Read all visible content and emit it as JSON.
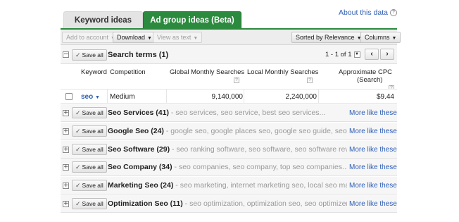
{
  "tabs": {
    "keyword_ideas": "Keyword ideas",
    "ad_group_ideas": "Ad group ideas (Beta)"
  },
  "about": "About this data",
  "help_glyph": "?",
  "toolbar": {
    "add_to_account": "Add to account",
    "download": "Download",
    "view_as_text": "View as text",
    "sorted_by": "Sorted by Relevance",
    "columns": "Columns"
  },
  "search_terms": {
    "save_all": "Save all",
    "title": "Search terms (1)",
    "pager": "1 - 1 of 1",
    "prev": "‹",
    "next": "›"
  },
  "columns": {
    "keyword": "Keyword",
    "competition": "Competition",
    "global_monthly": "Global Monthly Searches",
    "local_monthly": "Local Monthly Searches",
    "cpc_line1": "Approximate CPC",
    "cpc_line2": "(Search)"
  },
  "seo_row": {
    "keyword": "seo",
    "competition": "Medium",
    "global": "9,140,000",
    "local": "2,240,000",
    "cpc": "$9.44"
  },
  "groups": [
    {
      "title": "Seo Services (41)",
      "keywords": " - seo services, seo service, best seo services...",
      "more": "More like these",
      "save_all": "Save all"
    },
    {
      "title": "Google Seo (24)",
      "keywords": " - google seo, google places seo, google seo guide, seo google...",
      "more": "More like these",
      "save_all": "Save all"
    },
    {
      "title": "Seo Software (29)",
      "keywords": " - seo ranking software, seo software, seo software reviews...",
      "more": "More like these",
      "save_all": "Save all"
    },
    {
      "title": "Seo Company (34)",
      "keywords": " - seo companies, seo company, top seo companies...",
      "more": "More like these",
      "save_all": "Save all"
    },
    {
      "title": "Marketing Seo (24)",
      "keywords": " - seo marketing, internet marketing seo, local seo marketing...",
      "more": "More like these",
      "save_all": "Save all"
    },
    {
      "title": "Optimization Seo (11)",
      "keywords": " - seo optimization, optimization seo, seo optimizer...",
      "more": "More like these",
      "save_all": "Save all"
    }
  ],
  "colors": {
    "accent_green": "#2b8a3e",
    "link_blue": "#2d5db5"
  }
}
